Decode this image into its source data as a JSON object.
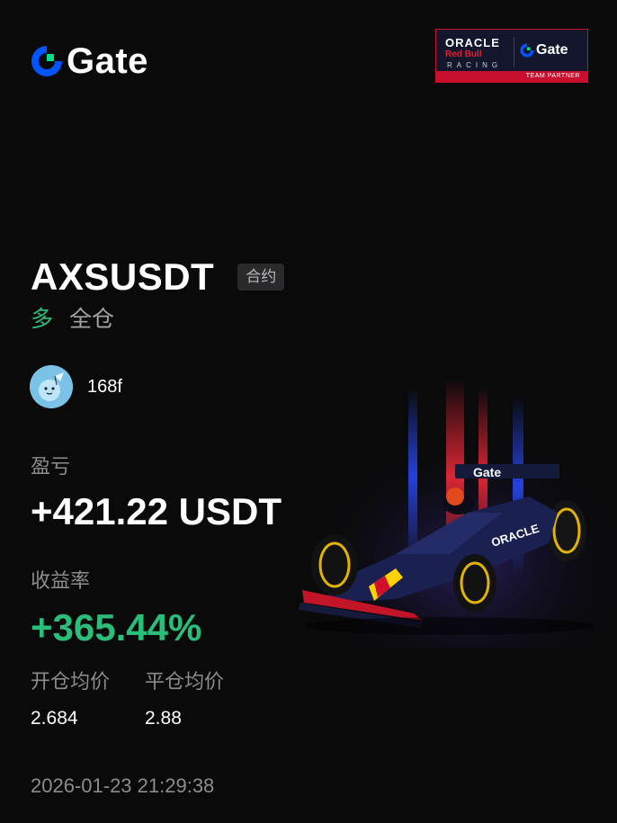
{
  "brand": {
    "name": "Gate",
    "logo_icon": "gate-logo-icon"
  },
  "partner_badge": {
    "oracle": "ORACLE",
    "red_bull": "Red Bull",
    "racing": "RACING",
    "brand": "Gate",
    "caption": "TEAM PARTNER"
  },
  "position": {
    "symbol": "AXSUSDT",
    "tag": "合约",
    "side": "多",
    "margin_mode": "全仓"
  },
  "user": {
    "name": "168f",
    "avatar_icon": "avatar-icon"
  },
  "pnl": {
    "label": "盈亏",
    "value": "+421.22 USDT"
  },
  "roi": {
    "label": "收益率",
    "value": "+365.44%"
  },
  "prices": {
    "entry_label": "开仓均价",
    "entry_value": "2.684",
    "exit_label": "平仓均价",
    "exit_value": "2.88"
  },
  "timestamp": "2026-01-23 21:29:38",
  "colors": {
    "background": "#0a0a0b",
    "accent_blue": "#0055ff",
    "accent_green": "#00e08a",
    "profit_green": "#2bbd7a",
    "muted_text": "#8c8c8c"
  },
  "images": {
    "hero_car": "f1-race-car-illustration"
  }
}
